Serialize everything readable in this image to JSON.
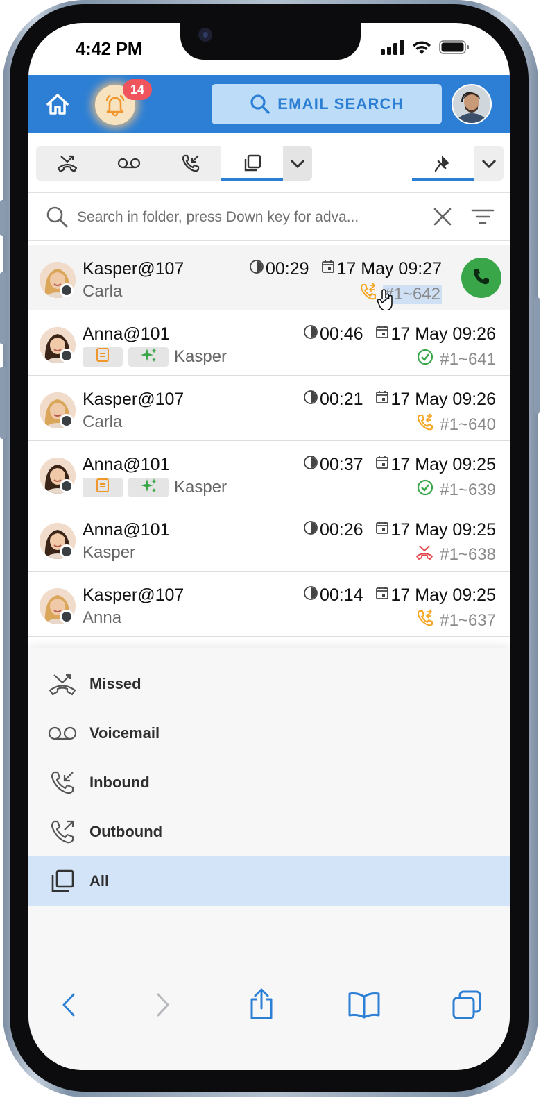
{
  "status_bar": {
    "time": "4:42 PM"
  },
  "header": {
    "notification_count": "14",
    "email_search_label": "EMAIL SEARCH"
  },
  "toolbar": {
    "tabs": [
      "missed-icon",
      "voicemail-icon",
      "inbound-icon",
      "all-icon"
    ],
    "active_tab": "all"
  },
  "search": {
    "placeholder": "Search in folder, press Down key for adva..."
  },
  "calls": [
    {
      "caller": "Kasper@107",
      "callee": "Carla",
      "duration": "00:29",
      "datetime": "17 May 09:27",
      "id": "#1~642",
      "status": "answered-transfer",
      "chips": false
    },
    {
      "caller": "Anna@101",
      "callee": "Kasper",
      "duration": "00:46",
      "datetime": "17 May 09:26",
      "id": "#1~641",
      "status": "ok",
      "chips": true
    },
    {
      "caller": "Kasper@107",
      "callee": "Carla",
      "duration": "00:21",
      "datetime": "17 May 09:26",
      "id": "#1~640",
      "status": "answered-transfer",
      "chips": false
    },
    {
      "caller": "Anna@101",
      "callee": "Kasper",
      "duration": "00:37",
      "datetime": "17 May 09:25",
      "id": "#1~639",
      "status": "ok",
      "chips": true
    },
    {
      "caller": "Anna@101",
      "callee": "Kasper",
      "duration": "00:26",
      "datetime": "17 May 09:25",
      "id": "#1~638",
      "status": "missed",
      "chips": false
    },
    {
      "caller": "Kasper@107",
      "callee": "Anna",
      "duration": "00:14",
      "datetime": "17 May 09:25",
      "id": "#1~637",
      "status": "answered-transfer",
      "chips": false
    }
  ],
  "filter_menu": {
    "items": [
      {
        "label": "Missed",
        "icon": "missed-icon"
      },
      {
        "label": "Voicemail",
        "icon": "voicemail-icon"
      },
      {
        "label": "Inbound",
        "icon": "inbound-icon"
      },
      {
        "label": "Outbound",
        "icon": "outbound-icon"
      },
      {
        "label": "All",
        "icon": "all-icon"
      }
    ],
    "selected": "All"
  },
  "colors": {
    "brand": "#2d7fd5",
    "call_green": "#3aa64a",
    "transfer_orange": "#f5a623",
    "ok_green": "#3aa64a",
    "missed_red": "#e5484d",
    "selected_row": "#d3e4f8"
  }
}
